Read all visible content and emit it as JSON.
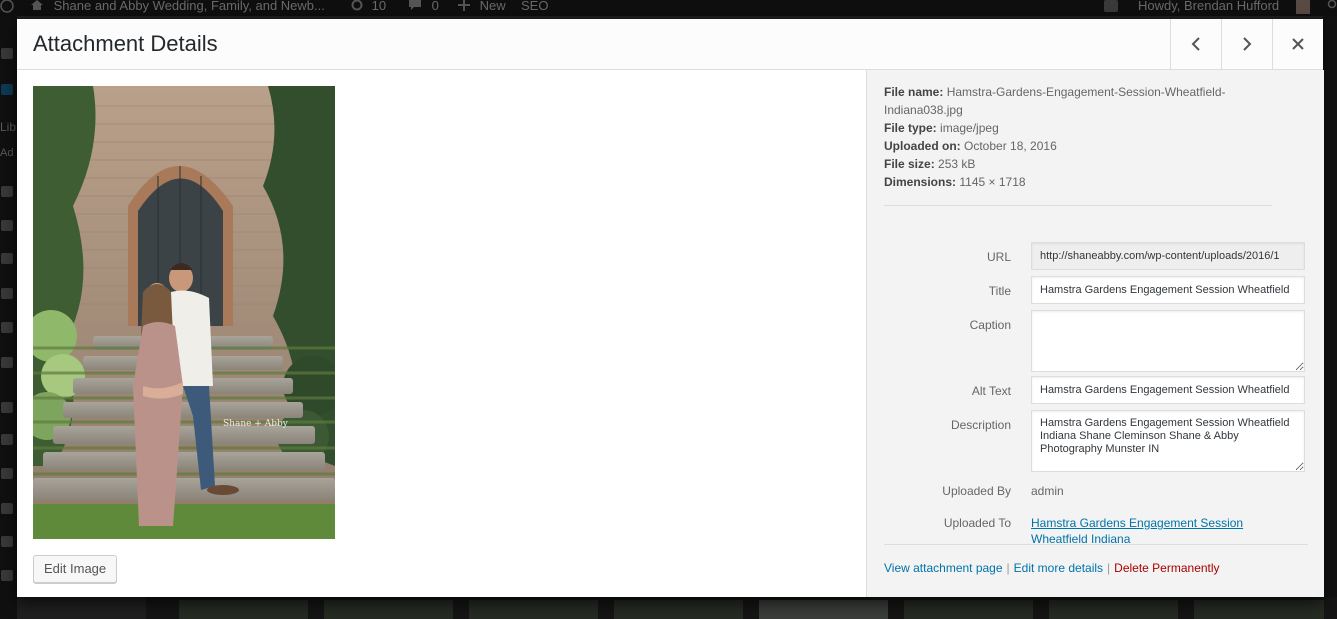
{
  "admin_bar": {
    "site_name": "Shane and Abby Wedding, Family, and Newb...",
    "updates_count": "10",
    "comments_count": "0",
    "new_label": "New",
    "seo_label": "SEO",
    "howdy": "Howdy, Brendan Hufford"
  },
  "admin_menu": {
    "library_partial": "Lib",
    "add_partial": "Ad"
  },
  "modal": {
    "title": "Attachment Details",
    "prev_icon": "chevron-left-icon",
    "next_icon": "chevron-right-icon",
    "close_icon": "close-icon"
  },
  "media": {
    "edit_image_label": "Edit Image",
    "watermark": "Shane + Abby"
  },
  "file_info": {
    "file_name_label": "File name:",
    "file_name": "Hamstra-Gardens-Engagement-Session-Wheatfield-Indiana038.jpg",
    "file_type_label": "File type:",
    "file_type": "image/jpeg",
    "uploaded_on_label": "Uploaded on:",
    "uploaded_on": "October 18, 2016",
    "file_size_label": "File size:",
    "file_size": "253 kB",
    "dimensions_label": "Dimensions:",
    "dimensions": "1145 × 1718"
  },
  "fields": {
    "url_label": "URL",
    "url_value": "http://shaneabby.com/wp-content/uploads/2016/1",
    "title_label": "Title",
    "title_value": "Hamstra Gardens Engagement Session Wheatfield",
    "caption_label": "Caption",
    "caption_value": "",
    "alt_label": "Alt Text",
    "alt_value": "Hamstra Gardens Engagement Session Wheatfield",
    "description_label": "Description",
    "description_value": "Hamstra Gardens Engagement Session Wheatfield Indiana Shane Cleminson Shane & Abby Photography Munster IN",
    "uploaded_by_label": "Uploaded By",
    "uploaded_by_value": "admin",
    "uploaded_to_label": "Uploaded To",
    "uploaded_to_value": "Hamstra Gardens Engagement Session Wheatfield Indiana"
  },
  "actions": {
    "view_page": "View attachment page",
    "edit_more": "Edit more details",
    "delete": "Delete Permanently",
    "separator": "|"
  },
  "colors": {
    "link": "#0073aa",
    "delete": "#aa0000",
    "sidebar_bg": "#f3f3f3"
  }
}
